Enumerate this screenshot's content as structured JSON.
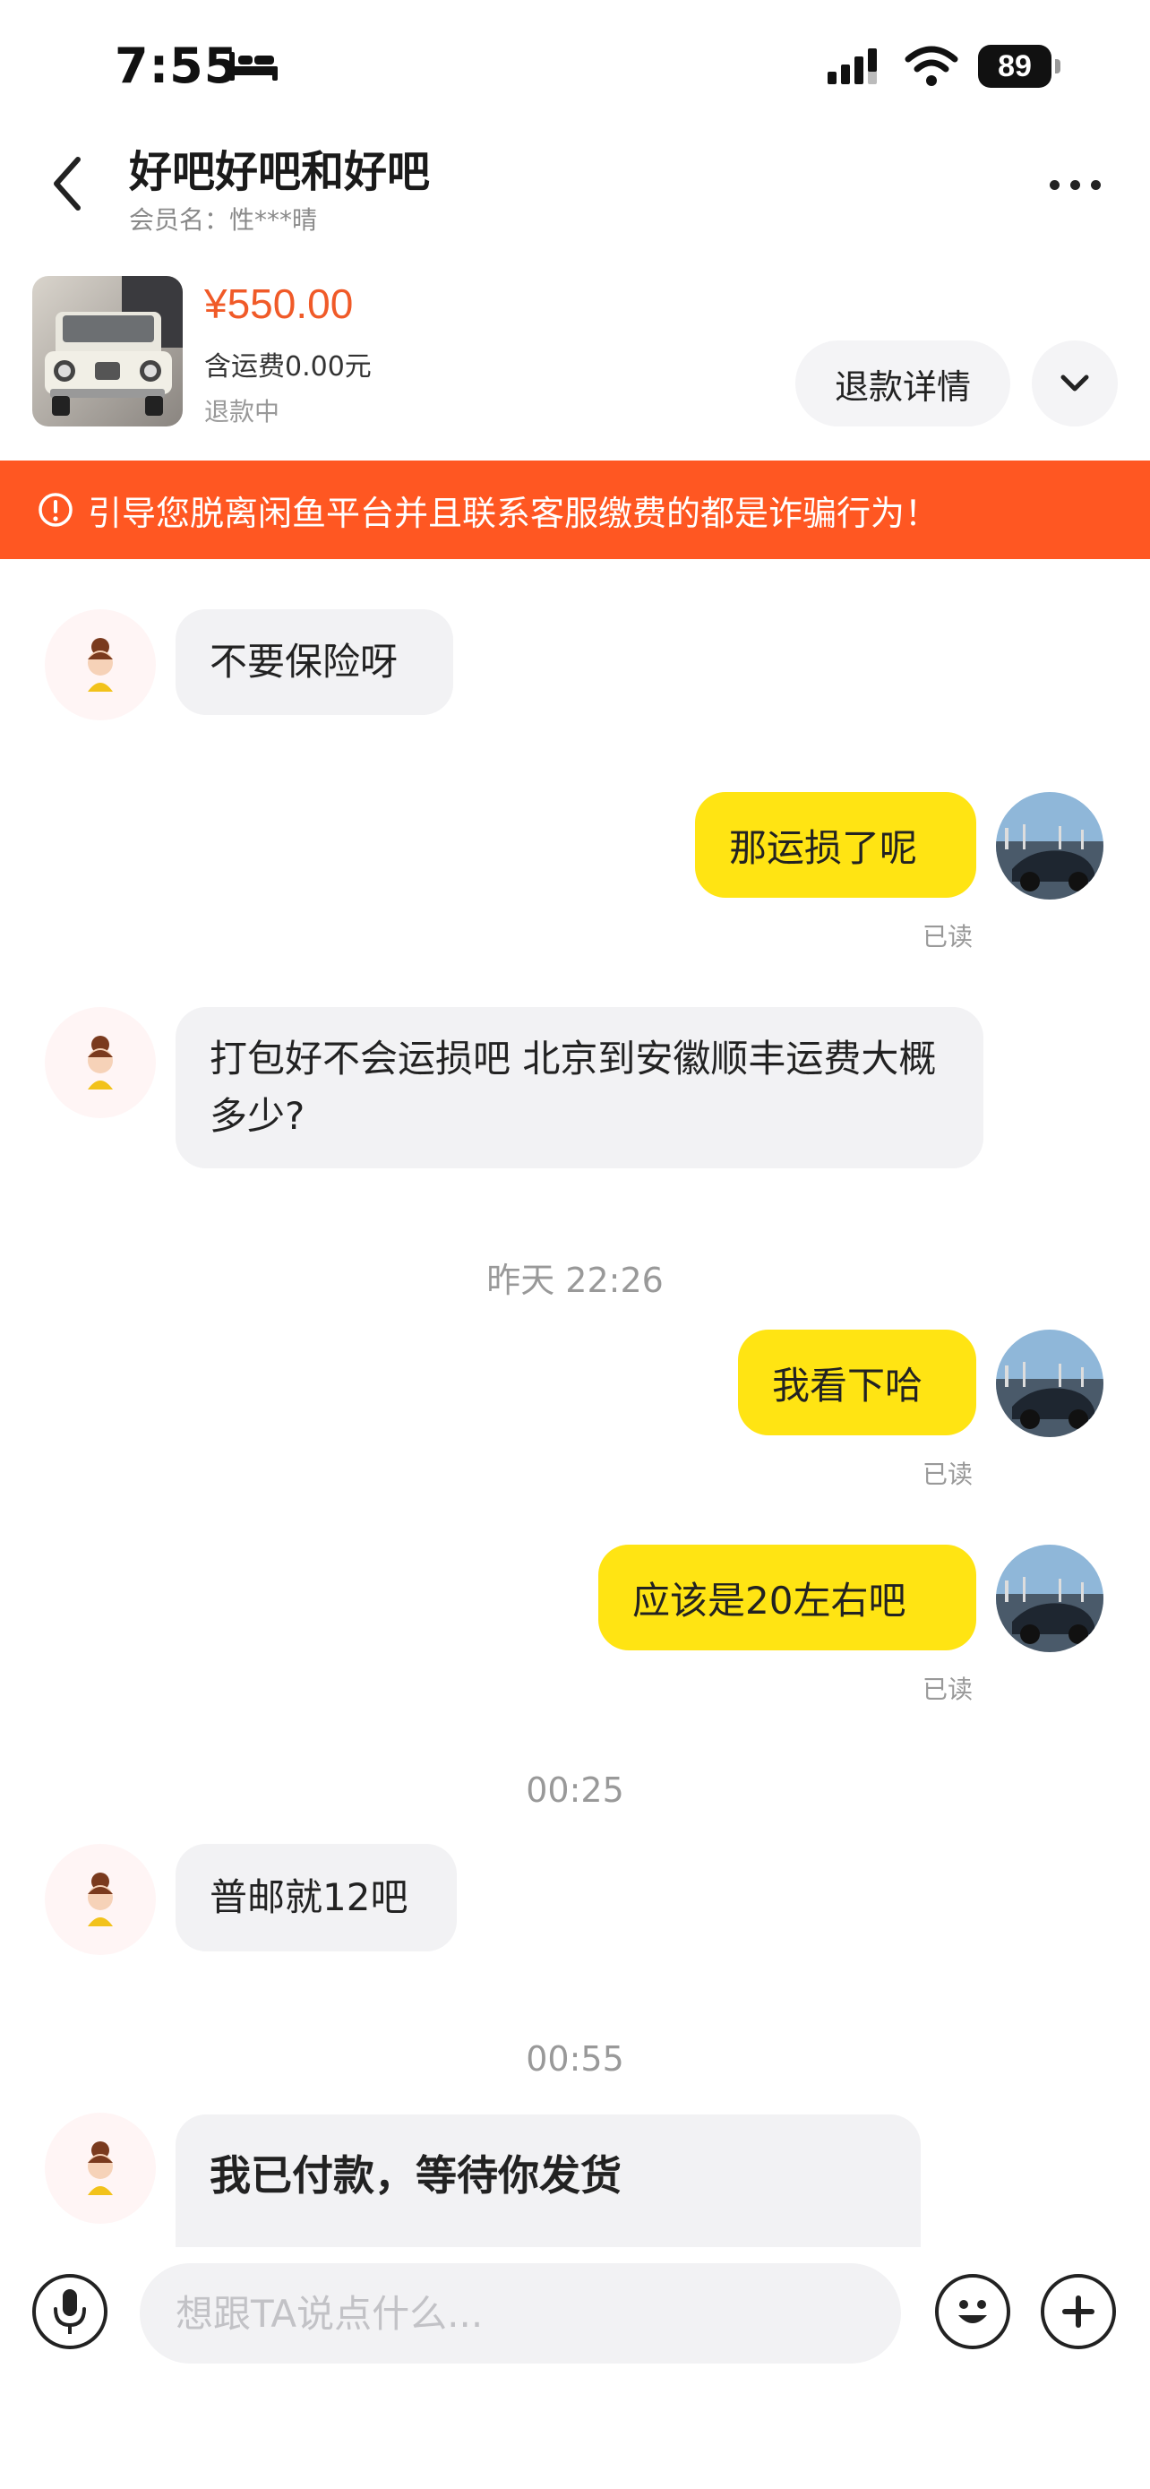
{
  "status_bar": {
    "time": "7:55",
    "battery": "89"
  },
  "header": {
    "title": "好吧好吧和好吧",
    "member_label": "会员名：性***晴"
  },
  "product": {
    "price": "¥550.00",
    "shipping": "含运费0.00元",
    "status": "退款中",
    "refund_detail_label": "退款详情"
  },
  "warning": {
    "text": "引导您脱离闲鱼平台并且联系客服缴费的都是诈骗行为！"
  },
  "messages": [
    {
      "side": "in",
      "text": "不要保险呀"
    },
    {
      "side": "out",
      "text": "那运损了呢",
      "read": "已读"
    },
    {
      "side": "in",
      "text": "打包好不会运损吧 北京到安徽顺丰运费大概多少?"
    },
    {
      "side": "time",
      "text": "昨天 22:26"
    },
    {
      "side": "out",
      "text": "我看下哈",
      "read": "已读"
    },
    {
      "side": "out",
      "text": "应该是20左右吧",
      "read": "已读"
    },
    {
      "side": "time",
      "text": "00:25"
    },
    {
      "side": "in",
      "text": "普邮就12吧"
    },
    {
      "side": "time",
      "text": "00:55"
    },
    {
      "side": "in",
      "text": "我已付款，等待你发货"
    }
  ],
  "input": {
    "placeholder": "想跟TA说点什么..."
  },
  "colors": {
    "accent": "#ff5722",
    "price": "#f05a28",
    "bubble_out": "#ffe413",
    "bubble_in": "#f2f2f4"
  },
  "icons": [
    "bed-icon",
    "signal-icon",
    "wifi-icon",
    "back-icon",
    "more-icon",
    "chevron-down-icon",
    "alert-icon",
    "mic-icon",
    "emoji-icon",
    "plus-icon"
  ]
}
